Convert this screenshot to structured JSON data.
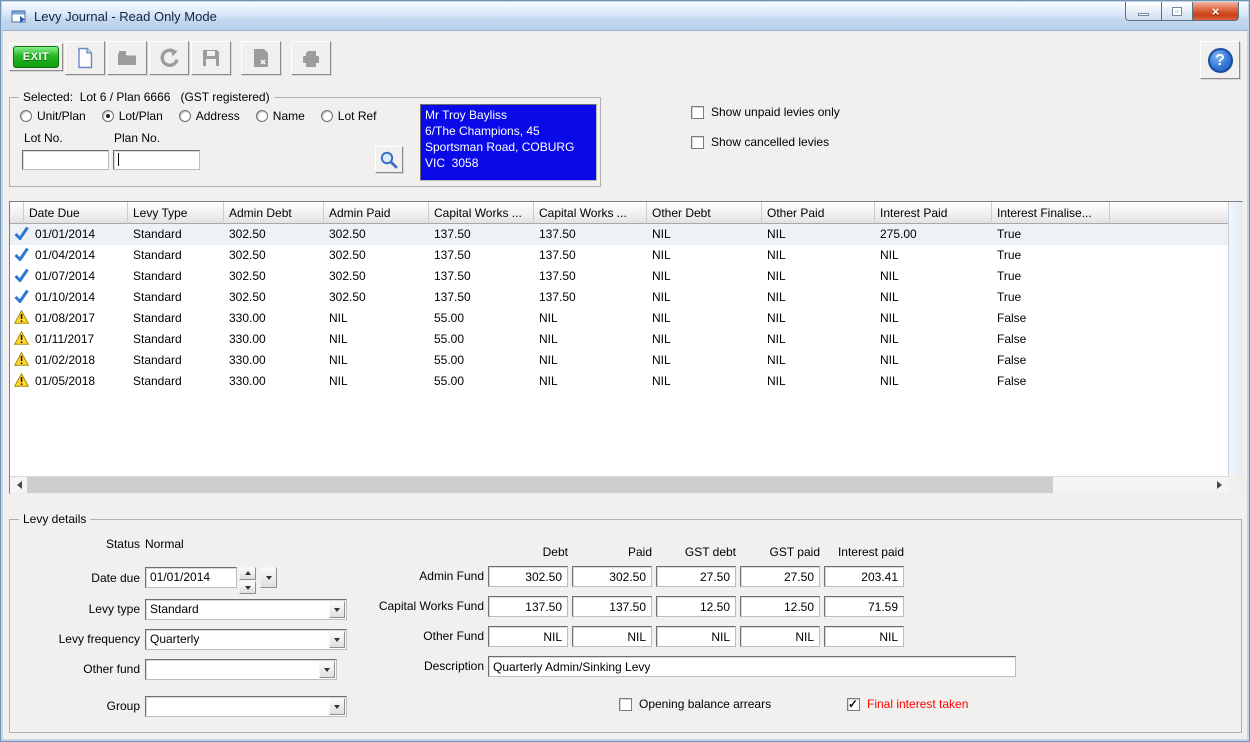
{
  "window": {
    "title": "Levy Journal - Read Only Mode",
    "controls": [
      "minimize",
      "maximize",
      "close"
    ]
  },
  "colors": {
    "selection_blue": "#0a0ae8",
    "alert_red": "#ff0000",
    "paid_check_blue": "#2e79d0",
    "warning_yellow": "#ffd633",
    "exit_green": "#18a818"
  },
  "toolbar": {
    "exit_label": "EXIT",
    "buttons": [
      {
        "icon": "new-document",
        "enabled": true
      },
      {
        "icon": "open-folder",
        "enabled": false
      },
      {
        "icon": "undo",
        "enabled": false
      },
      {
        "icon": "save",
        "enabled": false
      },
      {
        "icon": "export-document",
        "enabled": false
      },
      {
        "icon": "print",
        "enabled": false
      }
    ],
    "help_icon": "help-question"
  },
  "selected_group": {
    "legend": "Selected:  Lot 6 / Plan 6666   (GST registered)",
    "radios": [
      {
        "label": "Unit/Plan",
        "selected": false
      },
      {
        "label": "Lot/Plan",
        "selected": true
      },
      {
        "label": "Address",
        "selected": false
      },
      {
        "label": "Name",
        "selected": false
      },
      {
        "label": "Lot Ref",
        "selected": false
      }
    ],
    "lot_no_label": "Lot No.",
    "plan_no_label": "Plan No.",
    "lot_no_value": "",
    "plan_no_value": "",
    "search_icon": "magnifier",
    "address": [
      "Mr Troy Bayliss",
      "6/The Champions, 45",
      "Sportsman Road, COBURG",
      "VIC  3058"
    ]
  },
  "filters": {
    "show_unpaid": {
      "label": "Show unpaid levies only",
      "checked": false
    },
    "show_cancelled": {
      "label": "Show cancelled levies",
      "checked": false
    }
  },
  "levy_table": {
    "columns": [
      "Date Due",
      "Levy Type",
      "Admin Debt",
      "Admin Paid",
      "Capital Works ...",
      "Capital Works ...",
      "Other Debt",
      "Other Paid",
      "Interest Paid",
      "Interest Finalise..."
    ],
    "rows": [
      {
        "icon": "paid",
        "selected": true,
        "cells": [
          "01/01/2014",
          "Standard",
          "302.50",
          "302.50",
          "137.50",
          "137.50",
          "NIL",
          "NIL",
          "275.00",
          "True"
        ]
      },
      {
        "icon": "paid",
        "selected": false,
        "cells": [
          "01/04/2014",
          "Standard",
          "302.50",
          "302.50",
          "137.50",
          "137.50",
          "NIL",
          "NIL",
          "NIL",
          "True"
        ]
      },
      {
        "icon": "paid",
        "selected": false,
        "cells": [
          "01/07/2014",
          "Standard",
          "302.50",
          "302.50",
          "137.50",
          "137.50",
          "NIL",
          "NIL",
          "NIL",
          "True"
        ]
      },
      {
        "icon": "paid",
        "selected": false,
        "cells": [
          "01/10/2014",
          "Standard",
          "302.50",
          "302.50",
          "137.50",
          "137.50",
          "NIL",
          "NIL",
          "NIL",
          "True"
        ]
      },
      {
        "icon": "warning",
        "selected": false,
        "cells": [
          "01/08/2017",
          "Standard",
          "330.00",
          "NIL",
          "55.00",
          "NIL",
          "NIL",
          "NIL",
          "NIL",
          "False"
        ]
      },
      {
        "icon": "warning",
        "selected": false,
        "cells": [
          "01/11/2017",
          "Standard",
          "330.00",
          "NIL",
          "55.00",
          "NIL",
          "NIL",
          "NIL",
          "NIL",
          "False"
        ]
      },
      {
        "icon": "warning",
        "selected": false,
        "cells": [
          "01/02/2018",
          "Standard",
          "330.00",
          "NIL",
          "55.00",
          "NIL",
          "NIL",
          "NIL",
          "NIL",
          "False"
        ]
      },
      {
        "icon": "warning",
        "selected": false,
        "cells": [
          "01/05/2018",
          "Standard",
          "330.00",
          "NIL",
          "55.00",
          "NIL",
          "NIL",
          "NIL",
          "NIL",
          "False"
        ]
      }
    ]
  },
  "levy_details": {
    "legend": "Levy details",
    "status_label": "Status",
    "status_value": "Normal",
    "date_due_label": "Date due",
    "date_due_value": "01/01/2014",
    "levy_type_label": "Levy type",
    "levy_type_value": "Standard",
    "levy_frequency_label": "Levy frequency",
    "levy_frequency_value": "Quarterly",
    "other_fund_label": "Other fund",
    "other_fund_value": "",
    "group_label": "Group",
    "group_value": "",
    "fund_grid": {
      "col_headers": [
        "Debt",
        "Paid",
        "GST debt",
        "GST paid",
        "Interest paid"
      ],
      "rows": [
        {
          "label": "Admin Fund",
          "values": [
            "302.50",
            "302.50",
            "27.50",
            "27.50",
            "203.41"
          ]
        },
        {
          "label": "Capital Works Fund",
          "values": [
            "137.50",
            "137.50",
            "12.50",
            "12.50",
            "71.59"
          ]
        },
        {
          "label": "Other Fund",
          "values": [
            "NIL",
            "NIL",
            "NIL",
            "NIL",
            "NIL"
          ]
        }
      ]
    },
    "description_label": "Description",
    "description_value": "Quarterly Admin/Sinking Levy",
    "opening_balance": {
      "label": "Opening balance arrears",
      "checked": false
    },
    "final_interest": {
      "label": "Final interest taken",
      "checked": true,
      "label_color": "#ff0000"
    }
  }
}
